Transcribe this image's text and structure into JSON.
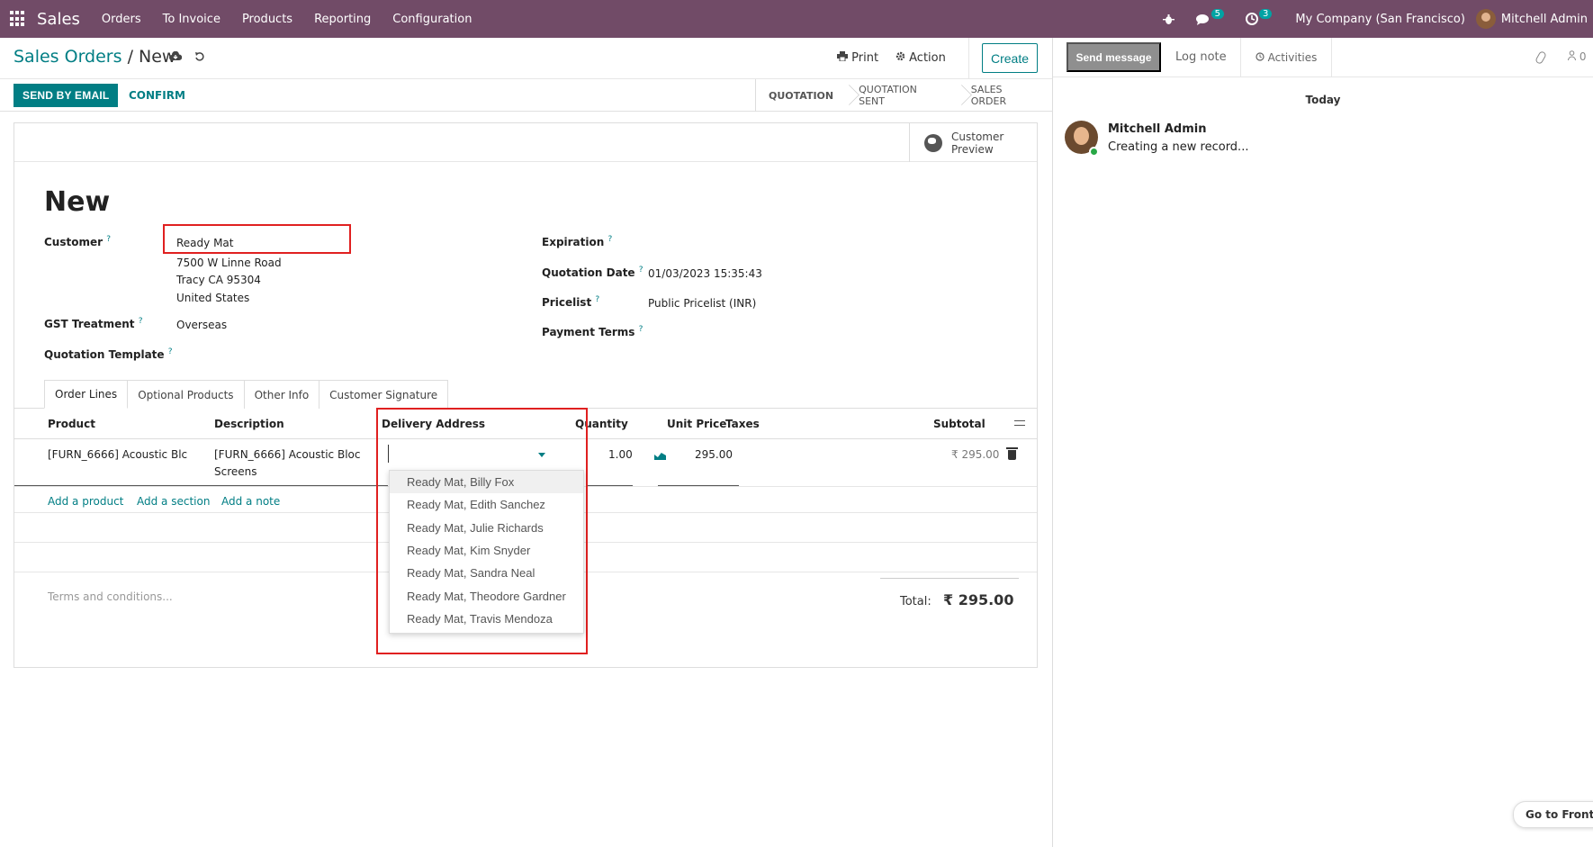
{
  "navbar": {
    "brand": "Sales",
    "menu": [
      "Orders",
      "To Invoice",
      "Products",
      "Reporting",
      "Configuration"
    ],
    "chat_badge": "5",
    "activity_badge": "3",
    "company": "My Company (San Francisco)",
    "user": "Mitchell Admin"
  },
  "control_panel": {
    "breadcrumb_parent": "Sales Orders",
    "breadcrumb_sep": "/",
    "breadcrumb_current": "New",
    "print_label": "Print",
    "action_label": "Action",
    "create_label": "Create"
  },
  "statusbar": {
    "send_email": "SEND BY EMAIL",
    "confirm": "CONFIRM",
    "stages": [
      "QUOTATION",
      "QUOTATION SENT",
      "SALES ORDER"
    ],
    "active_stage": "QUOTATION"
  },
  "form": {
    "preview_label_1": "Customer",
    "preview_label_2": "Preview",
    "title": "New",
    "customer_label": "Customer",
    "customer_value": "Ready Mat",
    "address": [
      "7500 W Linne Road",
      "Tracy CA 95304",
      "United States"
    ],
    "gst_label": "GST Treatment",
    "gst_value": "Overseas",
    "template_label": "Quotation Template",
    "expiration_label": "Expiration",
    "quotation_date_label": "Quotation Date",
    "quotation_date_value": "01/03/2023 15:35:43",
    "pricelist_label": "Pricelist",
    "pricelist_value": "Public Pricelist (INR)",
    "payment_terms_label": "Payment Terms",
    "help_mark": "?"
  },
  "tabs": [
    "Order Lines",
    "Optional Products",
    "Other Info",
    "Customer Signature"
  ],
  "order_lines": {
    "columns": [
      "Product",
      "Description",
      "Delivery Address",
      "Quantity",
      "Unit Price",
      "Taxes",
      "Subtotal"
    ],
    "row": {
      "product": "[FURN_6666] Acoustic Blc",
      "description_1": "[FURN_6666] Acoustic Bloc",
      "description_2": "Screens",
      "quantity": "1.00",
      "unit_price": "295.00",
      "subtotal": "₹ 295.00"
    },
    "add_product": "Add a product",
    "add_section": "Add a section",
    "add_note": "Add a note"
  },
  "delivery_dropdown": {
    "options": [
      "Ready Mat, Billy Fox",
      "Ready Mat, Edith Sanchez",
      "Ready Mat, Julie Richards",
      "Ready Mat, Kim Snyder",
      "Ready Mat, Sandra Neal",
      "Ready Mat, Theodore Gardner",
      "Ready Mat, Travis Mendoza"
    ],
    "highlighted_index": 0
  },
  "footer": {
    "terms_placeholder": "Terms and conditions...",
    "total_label": "Total:",
    "total_value": "₹ 295.00"
  },
  "chatter": {
    "send_message": "Send message",
    "log_note": "Log note",
    "activities": "Activities",
    "followers_count": "0",
    "date_separator": "Today",
    "author": "Mitchell Admin",
    "message": "Creating a new record...",
    "frontend_button": "Go to Frontend"
  },
  "colors": {
    "navbar": "#714b67",
    "primary": "#017e84",
    "highlight_box": "#e02020"
  }
}
